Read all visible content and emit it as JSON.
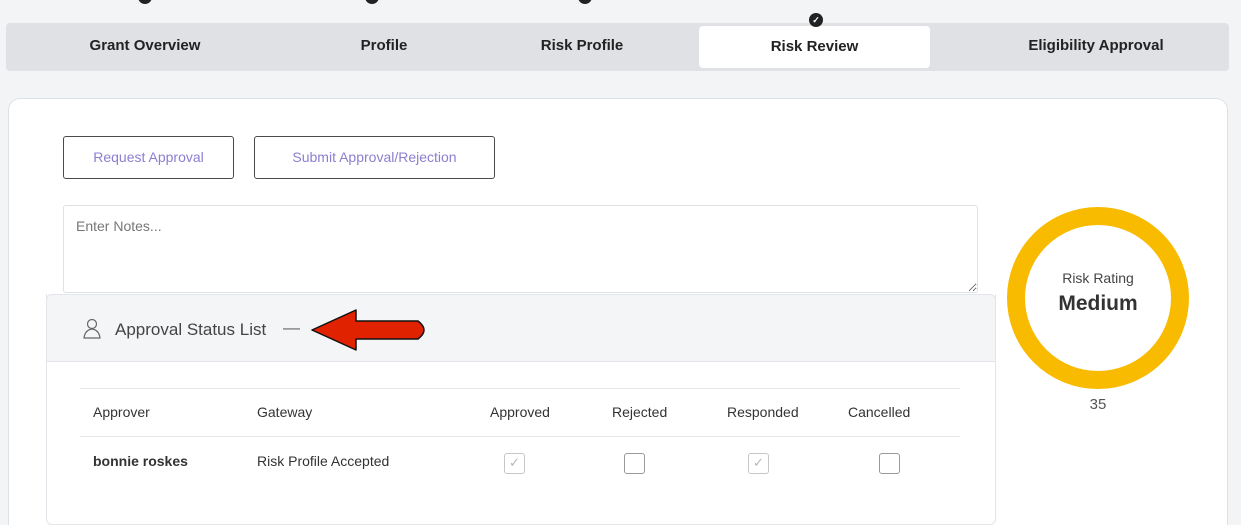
{
  "steps": [
    {
      "label": "Grant Overview",
      "completed": true,
      "active": false
    },
    {
      "label": "Profile",
      "completed": true,
      "active": false
    },
    {
      "label": "Risk Profile",
      "completed": true,
      "active": false
    },
    {
      "label": "Risk Review",
      "completed": true,
      "active": true
    },
    {
      "label": "Eligibility Approval",
      "completed": false,
      "active": false
    }
  ],
  "actions": {
    "request_approval": "Request Approval",
    "submit_approval": "Submit Approval/Rejection"
  },
  "notes": {
    "placeholder": "Enter Notes...",
    "value": ""
  },
  "approval": {
    "title": "Approval Status List",
    "collapse_symbol": "—",
    "columns": [
      "Approver",
      "Gateway",
      "Approved",
      "Rejected",
      "Responded",
      "Cancelled"
    ],
    "rows": [
      {
        "approver": "bonnie roskes",
        "gateway": "Risk Profile Accepted",
        "approved": true,
        "rejected": false,
        "responded": true,
        "cancelled": false
      }
    ]
  },
  "risk": {
    "label": "Risk Rating",
    "value": "Medium",
    "score": "35",
    "color": "#f8bb00"
  },
  "colors": {
    "accent_text": "#8a7fd0",
    "annotation_arrow": "#e02200"
  }
}
